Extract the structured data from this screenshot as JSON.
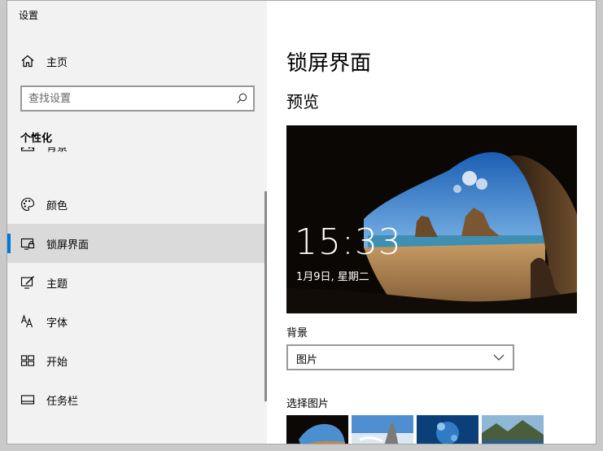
{
  "window": {
    "title": "设置"
  },
  "sidebar": {
    "home_label": "主页",
    "search_placeholder": "查找设置",
    "section_title": "个性化",
    "items": [
      {
        "label": "背景",
        "icon": "picture-icon"
      },
      {
        "label": "颜色",
        "icon": "palette-icon"
      },
      {
        "label": "锁屏界面",
        "icon": "lockscreen-icon",
        "active": true
      },
      {
        "label": "主题",
        "icon": "theme-icon"
      },
      {
        "label": "字体",
        "icon": "font-icon"
      },
      {
        "label": "开始",
        "icon": "start-icon"
      },
      {
        "label": "任务栏",
        "icon": "taskbar-icon"
      }
    ]
  },
  "main": {
    "title": "锁屏界面",
    "preview_title": "预览",
    "preview": {
      "time": "15:33",
      "date": "1月9日, 星期二"
    },
    "background_label": "背景",
    "background_value": "图片",
    "choose_label": "选择图片"
  },
  "colors": {
    "accent": "#0078d7",
    "sidebar_bg": "#f2f2f2",
    "active_bg": "#dadada"
  }
}
